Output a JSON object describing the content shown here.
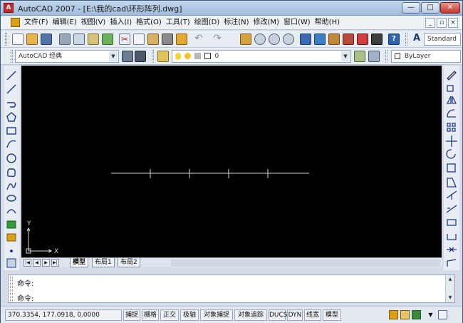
{
  "window": {
    "app_icon_letter": "A",
    "title": "AutoCAD 2007 - [E:\\我的cad\\环形阵列.dwg]",
    "minimize_glyph": "—",
    "maximize_glyph": "□",
    "close_glyph": "✕"
  },
  "menubar": {
    "items": [
      "文件(F)",
      "编辑(E)",
      "视图(V)",
      "插入(I)",
      "格式(O)",
      "工具(T)",
      "绘图(D)",
      "标注(N)",
      "修改(M)",
      "窗口(W)",
      "帮助(H)"
    ],
    "mdi": [
      "_",
      "▫",
      "×"
    ]
  },
  "toolbar_standard": {
    "text_style_value": "Standard"
  },
  "toolbar_workspace": {
    "workspace_value": "AutoCAD 经典",
    "layer_value": "0",
    "color_value": "ByLayer"
  },
  "canvas": {
    "ucs_y_label": "Y",
    "ucs_x_label": "X"
  },
  "layout_tabs": {
    "nav": [
      "|◀",
      "◀",
      "▶",
      "▶|"
    ],
    "tabs": [
      "模型",
      "布局1",
      "布局2"
    ],
    "active": "模型"
  },
  "command": {
    "line1": "命令:",
    "line2": "命令:",
    "scroll_up": "▲",
    "scroll_down": "▼"
  },
  "statusbar": {
    "coordinates": "370.3354, 177.0918, 0.0000",
    "buttons": [
      "捕捉",
      "栅格",
      "正交",
      "极轴",
      "对象捕捉",
      "对象追踪",
      "DUCS",
      "DYN",
      "线宽",
      "模型"
    ]
  },
  "colors": {
    "canvas_bg": "#000000",
    "drawing_line": "#d8d8d8",
    "title_bar": "#b3cbe6",
    "close_button": "#c2382c"
  }
}
